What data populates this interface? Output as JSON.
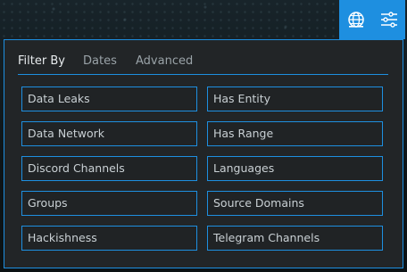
{
  "top_actions": {
    "globe_icon": "globe-icon",
    "filter_icon": "sliders-icon",
    "accent": "#1e8fe0"
  },
  "filter_panel": {
    "tabs": [
      {
        "label": "Filter By",
        "active": true
      },
      {
        "label": "Dates",
        "active": false
      },
      {
        "label": "Advanced",
        "active": false
      }
    ],
    "options": {
      "left": [
        "Data Leaks",
        "Data Network",
        "Discord Channels",
        "Groups",
        "Hackishness"
      ],
      "right": [
        "Has Entity",
        "Has Range",
        "Languages",
        "Source Domains",
        "Telegram Channels"
      ]
    }
  }
}
